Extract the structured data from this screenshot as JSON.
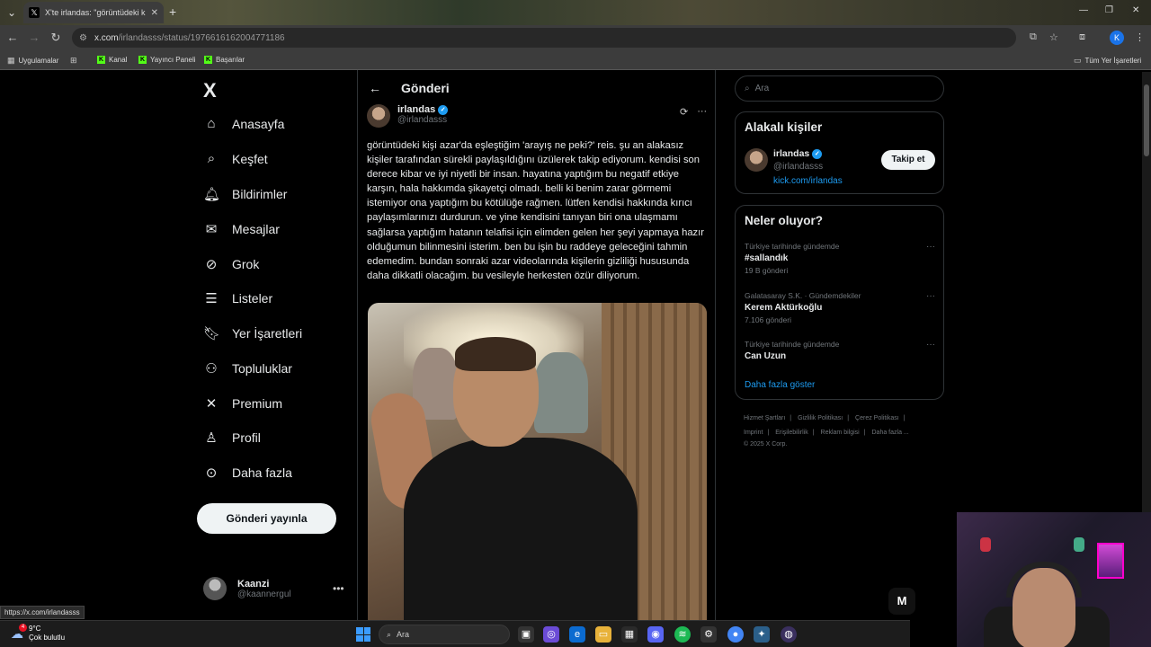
{
  "browser": {
    "tab_title": "X'te irlandas: \"görüntüdeki kişi",
    "url_host": "x.com",
    "url_path": "/irlandasss/status/1976616162004771186",
    "profile_initial": "K",
    "bookmarks": [
      "Uygulamalar",
      "Kanal",
      "Yayıncı Paneli",
      "Başarılar"
    ],
    "all_bookmarks": "Tüm Yer İşaretleri",
    "status_url": "https://x.com/irlandasss"
  },
  "nav": {
    "logo": "X",
    "items": [
      {
        "label": "Anasayfa",
        "icon": "home-icon"
      },
      {
        "label": "Keşfet",
        "icon": "search-icon"
      },
      {
        "label": "Bildirimler",
        "icon": "bell-icon"
      },
      {
        "label": "Mesajlar",
        "icon": "mail-icon"
      },
      {
        "label": "Grok",
        "icon": "grok-icon"
      },
      {
        "label": "Listeler",
        "icon": "list-icon"
      },
      {
        "label": "Yer İşaretleri",
        "icon": "bookmark-icon"
      },
      {
        "label": "Topluluklar",
        "icon": "people-icon"
      },
      {
        "label": "Premium",
        "icon": "x-premium-icon"
      },
      {
        "label": "Profil",
        "icon": "person-icon"
      },
      {
        "label": "Daha fazla",
        "icon": "more-circle-icon"
      }
    ],
    "post_button": "Gönderi yayınla",
    "account": {
      "name": "Kaanzi",
      "handle": "@kaannergul"
    }
  },
  "post": {
    "header": "Gönderi",
    "author_name": "irlandas",
    "author_handle": "@irlandasss",
    "text": "görüntüdeki kişi azar'da eşleştiğim 'arayış ne peki?' reis. şu an alakasız kişiler tarafından sürekli paylaşıldığını üzülerek takip ediyorum. kendisi son derece kibar ve iyi niyetli bir insan. hayatına yaptığım bu negatif etkiye karşın, hala hakkımda şikayetçi olmadı. belli ki benim zarar görmemi istemiyor ona yaptığım bu kötülüğe rağmen. lütfen kendisi hakkında kırıcı paylaşımlarınızı durdurun. ve yine kendisini tanıyan biri ona ulaşmamı sağlarsa yaptığım hatanın telafisi için elimden gelen her şeyi yapmaya hazır olduğumun bilinmesini isterim. ben bu işin bu raddeye geleceğini tahmin edemedim. bundan sonraki azar videolarında kişilerin gizliliği hususunda daha dikkatli olacağım. bu vesileyle herkesten özür diliyorum."
  },
  "sidebar": {
    "search_placeholder": "Ara",
    "related": {
      "title": "Alakalı kişiler",
      "name": "irlandas",
      "handle": "@irlandasss",
      "link": "kick.com/irlandas",
      "follow": "Takip et"
    },
    "trends": {
      "title": "Neler oluyor?",
      "items": [
        {
          "context": "Türkiye tarihinde gündemde",
          "title": "#sallandık",
          "count": "19 B gönderi"
        },
        {
          "context": "Galatasaray S.K. · Gündemdekiler",
          "title": "Kerem Aktürkoğlu",
          "count": "7.106 gönderi"
        },
        {
          "context": "Türkiye tarihinde gündemde",
          "title": "Can Uzun",
          "count": ""
        }
      ],
      "show_more": "Daha fazla göster"
    },
    "footer": {
      "links": [
        "Hizmet Şartları",
        "Gizlilik Politikası",
        "Çerez Politikası",
        "Imprint",
        "Erişilebilirlik",
        "Reklam bilgisi",
        "Daha fazla ..."
      ],
      "copyright": "© 2025 X Corp."
    },
    "messages_fab": "M"
  },
  "taskbar": {
    "temperature": "9°C",
    "weather": "Çok bulutlu",
    "weather_badge": "4",
    "search": "Ara"
  }
}
